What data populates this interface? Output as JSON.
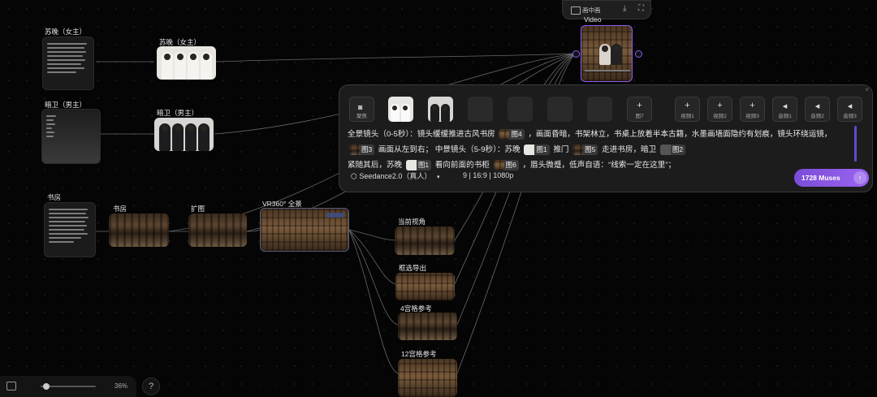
{
  "colors": {
    "accent": "#8b5cf6",
    "canvas": "#050505",
    "panel": "#1c1c1d"
  },
  "top_toolbar": {
    "pip_label": "画中画",
    "icons": [
      "pip-icon",
      "download-icon",
      "fullscreen-icon"
    ]
  },
  "video_node": {
    "title": "Video"
  },
  "nodes": {
    "su_wan_text": {
      "title": "苏晚（女主）"
    },
    "su_wan_image": {
      "title": "苏晚（女主）"
    },
    "guard_text": {
      "title": "暗卫（男主）"
    },
    "guard_image": {
      "title": "暗卫（男主）"
    },
    "study_text": {
      "title": "书房"
    },
    "study_image": {
      "title": "书房"
    },
    "expand": {
      "title": "扩图"
    },
    "vr360": {
      "title": "VR360° 全景"
    },
    "current_view": {
      "title": "当前视角"
    },
    "frame_export": {
      "title": "框选导出"
    },
    "grid4": {
      "title": "4宫格参考"
    },
    "grid12": {
      "title": "12宫格参考"
    }
  },
  "panel": {
    "focus_label": "聚焦",
    "add_slots": [
      {
        "label": "图7"
      },
      {
        "label": "视频1"
      },
      {
        "label": "视频2"
      },
      {
        "label": "视频3"
      },
      {
        "label": "音频1"
      },
      {
        "label": "音频2"
      },
      {
        "label": "音频3"
      }
    ],
    "prompt": {
      "l1a": "全景镜头（0-5秒）：镜头缓缓推进古风书房",
      "c1": "图4",
      "l1b": "，画面昏暗，书架林立，书桌上放着半本古籍，水墨画墙面隐约有划痕，镜头环绕运镜，",
      "c2": "图3",
      "l2a": "画面从左到右；  中景镜头（5-9秒）：苏晚",
      "c3": "图1",
      "l2b": "推门",
      "c4": "图5",
      "l2c": "走进书房，暗卫",
      "c5": "图2",
      "l3a": "紧随其后，苏晚",
      "c6": "图1",
      "l3b": "看向前面的书柜",
      "c7": "图6",
      "l3c": "，眉头微蹙，低声自语：“线索一定在这里”；"
    },
    "model": "Seedance2.0（真人）",
    "params": "9 | 16:9 | 1080p",
    "muses_label": "1728 Muses"
  },
  "zoom": {
    "value": "36%"
  },
  "help_label": "?"
}
